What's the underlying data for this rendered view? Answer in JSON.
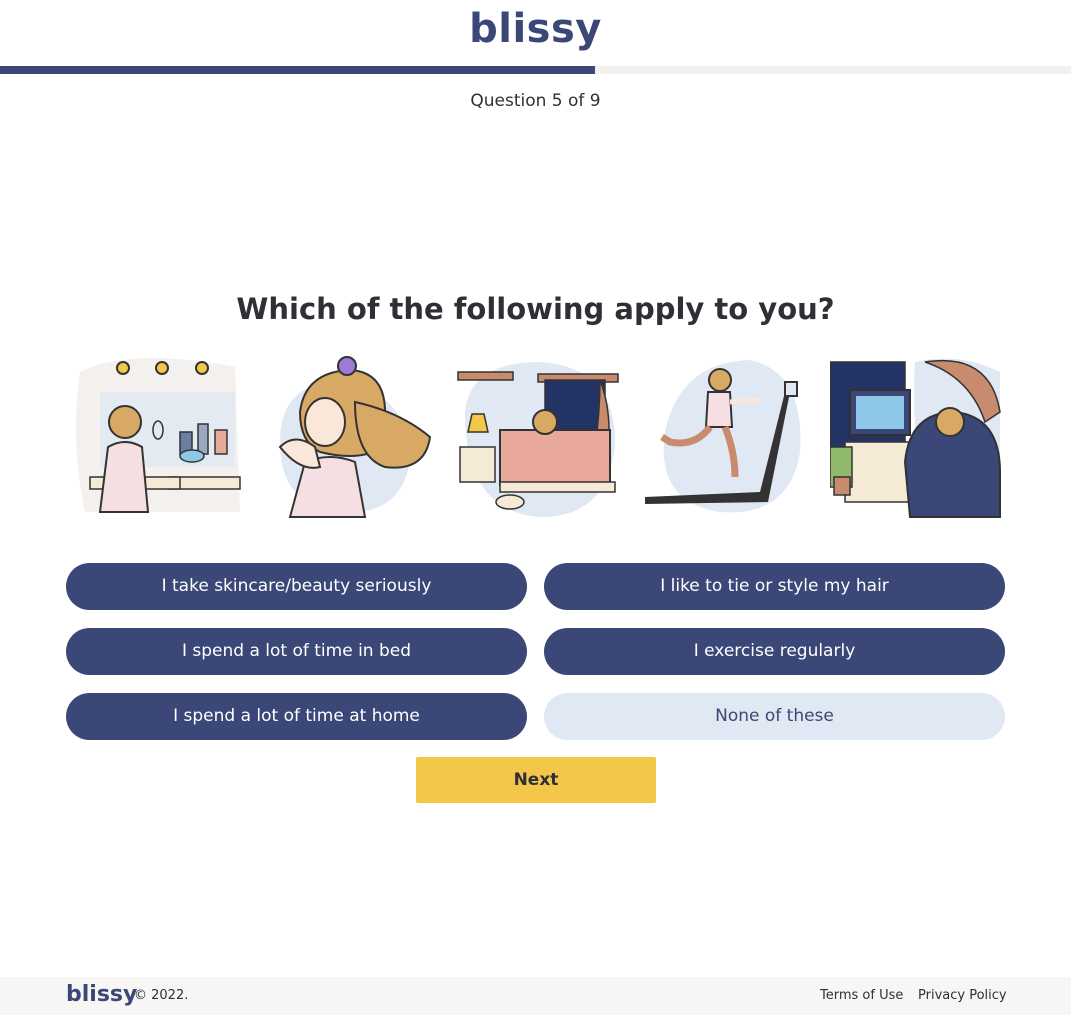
{
  "header": {
    "logo_text": "blissy",
    "progress": {
      "current": 5,
      "total": 9,
      "fraction": 0.556
    },
    "brand_color": "#3a4777"
  },
  "quiz": {
    "counter": "Question 5 of 9",
    "title": "Which of the following apply to you?",
    "illustrations": [
      {
        "icon": "skincare-illustration"
      },
      {
        "icon": "hair-styling-illustration"
      },
      {
        "icon": "bed-illustration"
      },
      {
        "icon": "treadmill-illustration"
      },
      {
        "icon": "home-desk-illustration"
      }
    ],
    "options": [
      {
        "label": "I take skincare/beauty seriously",
        "selected": true
      },
      {
        "label": "I like to tie or style my hair",
        "selected": true
      },
      {
        "label": "I spend a lot of time in bed",
        "selected": true
      },
      {
        "label": "I exercise regularly",
        "selected": true
      },
      {
        "label": "I spend a lot of time at home",
        "selected": true
      },
      {
        "label": "None of these",
        "selected": false
      }
    ],
    "next_label": "Next",
    "accent_color": "#f3c74a"
  },
  "footer": {
    "logo_text": "blissy",
    "copyright": "© 2022.",
    "links": [
      {
        "label": "Terms of Use"
      },
      {
        "label": "Privacy Policy"
      }
    ]
  }
}
